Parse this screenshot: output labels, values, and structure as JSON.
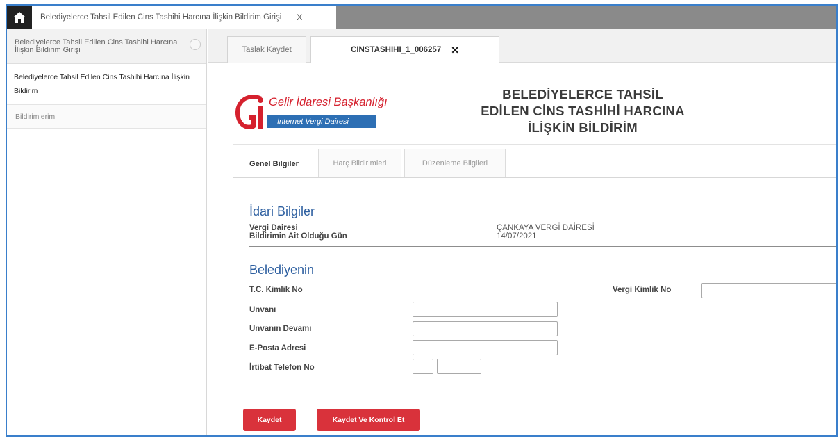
{
  "top_tab": {
    "title": "Belediyelerce Tahsil Edilen Cins Tashihi Harcına İlişkin Bildirim Girişi",
    "close": "X"
  },
  "left_panel": {
    "header": "Belediyelerce Tahsil Edilen Cins Tashihi Harcına İlişkin Bildirim Girişi",
    "items": [
      {
        "label": "Belediyelerce Tahsil Edilen Cins Tashihi Harcına İlişkin Bildirim"
      },
      {
        "label": "Bildirimlerim"
      }
    ]
  },
  "content_tabs": [
    {
      "label": "Taslak Kaydet"
    },
    {
      "label": "CINSTASHIHI_1_006257",
      "close": "✕"
    }
  ],
  "logo": {
    "title": "Gelir İdaresi Başkanlığı",
    "subtitle": "İnternet Vergi Dairesi"
  },
  "form_title": [
    "BELEDİYELERCE TAHSİL",
    "EDİLEN CİNS TASHİHİ HARCINA",
    "İLİŞKİN BİLDİRİM"
  ],
  "inner_tabs": [
    {
      "label": "Genel Bilgiler",
      "active": true
    },
    {
      "label": "Harç Bildirimleri",
      "active": false
    },
    {
      "label": "Düzenleme Bilgileri",
      "active": false
    }
  ],
  "idari": {
    "title": "İdari Bilgiler",
    "vergi_dairesi_label": "Vergi Dairesi",
    "vergi_dairesi_value": "ÇANKAYA VERGİ DAİRESİ",
    "gun_label": "Bildirimin Ait Olduğu Gün",
    "gun_value": "14/07/2021"
  },
  "belediye": {
    "title": "Belediyenin",
    "tc_label": "T.C. Kimlik No",
    "vkn_label": "Vergi Kimlik No",
    "vkn_value": "",
    "unvan_label": "Unvanı",
    "unvan_value": "",
    "unvan_devami_label": "Unvanın Devamı",
    "unvan_devami_value": "",
    "eposta_label": "E-Posta Adresi",
    "eposta_value": "",
    "telefon_label": "İrtibat Telefon No",
    "telefon_alan_kodu": "",
    "telefon_numara": ""
  },
  "buttons": {
    "kaydet": "Kaydet",
    "kaydet_kontrol": "Kaydet Ve Kontrol Et"
  },
  "colors": {
    "accent_blue": "#3a7fcb",
    "button_red": "#d9323b",
    "logo_red": "#d5212e",
    "section_title": "#2d5fa0"
  }
}
